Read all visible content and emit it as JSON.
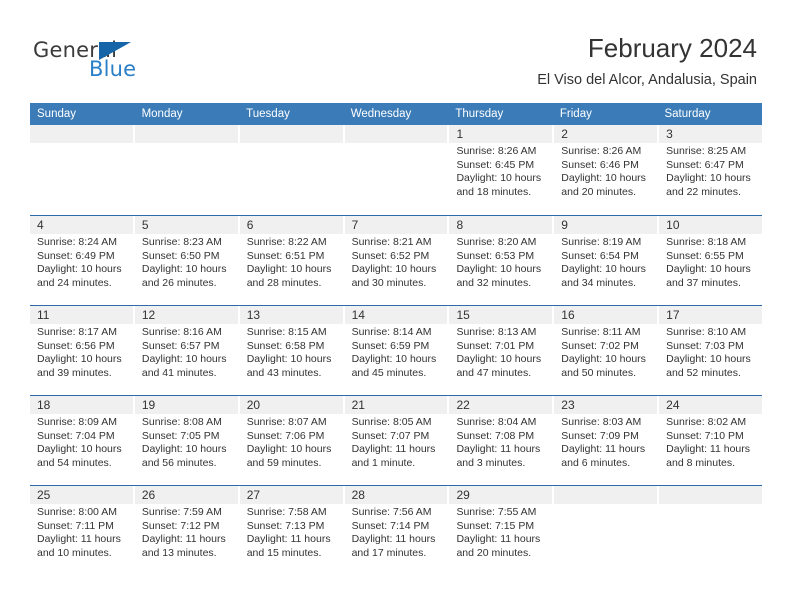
{
  "brand": {
    "name_part1": "General",
    "name_part2": "Blue",
    "accent_color": "#2a7fc9",
    "triangle_color": "#1565a8",
    "triangle_icon": "logo-triangle-icon"
  },
  "header": {
    "title": "February 2024",
    "subtitle": "El Viso del Alcor, Andalusia, Spain"
  },
  "calendar": {
    "header_bg": "#3b7cb8",
    "row_divider_color": "#2d6ca8",
    "day_band_bg": "#f0f0f0",
    "weekdays": [
      "Sunday",
      "Monday",
      "Tuesday",
      "Wednesday",
      "Thursday",
      "Friday",
      "Saturday"
    ],
    "weeks": [
      [
        {
          "day": "",
          "sunrise": "",
          "sunset": "",
          "daylight_line1": "",
          "daylight_line2": "",
          "empty": true
        },
        {
          "day": "",
          "sunrise": "",
          "sunset": "",
          "daylight_line1": "",
          "daylight_line2": "",
          "empty": true
        },
        {
          "day": "",
          "sunrise": "",
          "sunset": "",
          "daylight_line1": "",
          "daylight_line2": "",
          "empty": true
        },
        {
          "day": "",
          "sunrise": "",
          "sunset": "",
          "daylight_line1": "",
          "daylight_line2": "",
          "empty": true
        },
        {
          "day": "1",
          "sunrise": "Sunrise: 8:26 AM",
          "sunset": "Sunset: 6:45 PM",
          "daylight_line1": "Daylight: 10 hours",
          "daylight_line2": "and 18 minutes.",
          "empty": false
        },
        {
          "day": "2",
          "sunrise": "Sunrise: 8:26 AM",
          "sunset": "Sunset: 6:46 PM",
          "daylight_line1": "Daylight: 10 hours",
          "daylight_line2": "and 20 minutes.",
          "empty": false
        },
        {
          "day": "3",
          "sunrise": "Sunrise: 8:25 AM",
          "sunset": "Sunset: 6:47 PM",
          "daylight_line1": "Daylight: 10 hours",
          "daylight_line2": "and 22 minutes.",
          "empty": false
        }
      ],
      [
        {
          "day": "4",
          "sunrise": "Sunrise: 8:24 AM",
          "sunset": "Sunset: 6:49 PM",
          "daylight_line1": "Daylight: 10 hours",
          "daylight_line2": "and 24 minutes.",
          "empty": false
        },
        {
          "day": "5",
          "sunrise": "Sunrise: 8:23 AM",
          "sunset": "Sunset: 6:50 PM",
          "daylight_line1": "Daylight: 10 hours",
          "daylight_line2": "and 26 minutes.",
          "empty": false
        },
        {
          "day": "6",
          "sunrise": "Sunrise: 8:22 AM",
          "sunset": "Sunset: 6:51 PM",
          "daylight_line1": "Daylight: 10 hours",
          "daylight_line2": "and 28 minutes.",
          "empty": false
        },
        {
          "day": "7",
          "sunrise": "Sunrise: 8:21 AM",
          "sunset": "Sunset: 6:52 PM",
          "daylight_line1": "Daylight: 10 hours",
          "daylight_line2": "and 30 minutes.",
          "empty": false
        },
        {
          "day": "8",
          "sunrise": "Sunrise: 8:20 AM",
          "sunset": "Sunset: 6:53 PM",
          "daylight_line1": "Daylight: 10 hours",
          "daylight_line2": "and 32 minutes.",
          "empty": false
        },
        {
          "day": "9",
          "sunrise": "Sunrise: 8:19 AM",
          "sunset": "Sunset: 6:54 PM",
          "daylight_line1": "Daylight: 10 hours",
          "daylight_line2": "and 34 minutes.",
          "empty": false
        },
        {
          "day": "10",
          "sunrise": "Sunrise: 8:18 AM",
          "sunset": "Sunset: 6:55 PM",
          "daylight_line1": "Daylight: 10 hours",
          "daylight_line2": "and 37 minutes.",
          "empty": false
        }
      ],
      [
        {
          "day": "11",
          "sunrise": "Sunrise: 8:17 AM",
          "sunset": "Sunset: 6:56 PM",
          "daylight_line1": "Daylight: 10 hours",
          "daylight_line2": "and 39 minutes.",
          "empty": false
        },
        {
          "day": "12",
          "sunrise": "Sunrise: 8:16 AM",
          "sunset": "Sunset: 6:57 PM",
          "daylight_line1": "Daylight: 10 hours",
          "daylight_line2": "and 41 minutes.",
          "empty": false
        },
        {
          "day": "13",
          "sunrise": "Sunrise: 8:15 AM",
          "sunset": "Sunset: 6:58 PM",
          "daylight_line1": "Daylight: 10 hours",
          "daylight_line2": "and 43 minutes.",
          "empty": false
        },
        {
          "day": "14",
          "sunrise": "Sunrise: 8:14 AM",
          "sunset": "Sunset: 6:59 PM",
          "daylight_line1": "Daylight: 10 hours",
          "daylight_line2": "and 45 minutes.",
          "empty": false
        },
        {
          "day": "15",
          "sunrise": "Sunrise: 8:13 AM",
          "sunset": "Sunset: 7:01 PM",
          "daylight_line1": "Daylight: 10 hours",
          "daylight_line2": "and 47 minutes.",
          "empty": false
        },
        {
          "day": "16",
          "sunrise": "Sunrise: 8:11 AM",
          "sunset": "Sunset: 7:02 PM",
          "daylight_line1": "Daylight: 10 hours",
          "daylight_line2": "and 50 minutes.",
          "empty": false
        },
        {
          "day": "17",
          "sunrise": "Sunrise: 8:10 AM",
          "sunset": "Sunset: 7:03 PM",
          "daylight_line1": "Daylight: 10 hours",
          "daylight_line2": "and 52 minutes.",
          "empty": false
        }
      ],
      [
        {
          "day": "18",
          "sunrise": "Sunrise: 8:09 AM",
          "sunset": "Sunset: 7:04 PM",
          "daylight_line1": "Daylight: 10 hours",
          "daylight_line2": "and 54 minutes.",
          "empty": false
        },
        {
          "day": "19",
          "sunrise": "Sunrise: 8:08 AM",
          "sunset": "Sunset: 7:05 PM",
          "daylight_line1": "Daylight: 10 hours",
          "daylight_line2": "and 56 minutes.",
          "empty": false
        },
        {
          "day": "20",
          "sunrise": "Sunrise: 8:07 AM",
          "sunset": "Sunset: 7:06 PM",
          "daylight_line1": "Daylight: 10 hours",
          "daylight_line2": "and 59 minutes.",
          "empty": false
        },
        {
          "day": "21",
          "sunrise": "Sunrise: 8:05 AM",
          "sunset": "Sunset: 7:07 PM",
          "daylight_line1": "Daylight: 11 hours",
          "daylight_line2": "and 1 minute.",
          "empty": false
        },
        {
          "day": "22",
          "sunrise": "Sunrise: 8:04 AM",
          "sunset": "Sunset: 7:08 PM",
          "daylight_line1": "Daylight: 11 hours",
          "daylight_line2": "and 3 minutes.",
          "empty": false
        },
        {
          "day": "23",
          "sunrise": "Sunrise: 8:03 AM",
          "sunset": "Sunset: 7:09 PM",
          "daylight_line1": "Daylight: 11 hours",
          "daylight_line2": "and 6 minutes.",
          "empty": false
        },
        {
          "day": "24",
          "sunrise": "Sunrise: 8:02 AM",
          "sunset": "Sunset: 7:10 PM",
          "daylight_line1": "Daylight: 11 hours",
          "daylight_line2": "and 8 minutes.",
          "empty": false
        }
      ],
      [
        {
          "day": "25",
          "sunrise": "Sunrise: 8:00 AM",
          "sunset": "Sunset: 7:11 PM",
          "daylight_line1": "Daylight: 11 hours",
          "daylight_line2": "and 10 minutes.",
          "empty": false
        },
        {
          "day": "26",
          "sunrise": "Sunrise: 7:59 AM",
          "sunset": "Sunset: 7:12 PM",
          "daylight_line1": "Daylight: 11 hours",
          "daylight_line2": "and 13 minutes.",
          "empty": false
        },
        {
          "day": "27",
          "sunrise": "Sunrise: 7:58 AM",
          "sunset": "Sunset: 7:13 PM",
          "daylight_line1": "Daylight: 11 hours",
          "daylight_line2": "and 15 minutes.",
          "empty": false
        },
        {
          "day": "28",
          "sunrise": "Sunrise: 7:56 AM",
          "sunset": "Sunset: 7:14 PM",
          "daylight_line1": "Daylight: 11 hours",
          "daylight_line2": "and 17 minutes.",
          "empty": false
        },
        {
          "day": "29",
          "sunrise": "Sunrise: 7:55 AM",
          "sunset": "Sunset: 7:15 PM",
          "daylight_line1": "Daylight: 11 hours",
          "daylight_line2": "and 20 minutes.",
          "empty": false
        },
        {
          "day": "",
          "sunrise": "",
          "sunset": "",
          "daylight_line1": "",
          "daylight_line2": "",
          "empty": true
        },
        {
          "day": "",
          "sunrise": "",
          "sunset": "",
          "daylight_line1": "",
          "daylight_line2": "",
          "empty": true
        }
      ]
    ]
  }
}
